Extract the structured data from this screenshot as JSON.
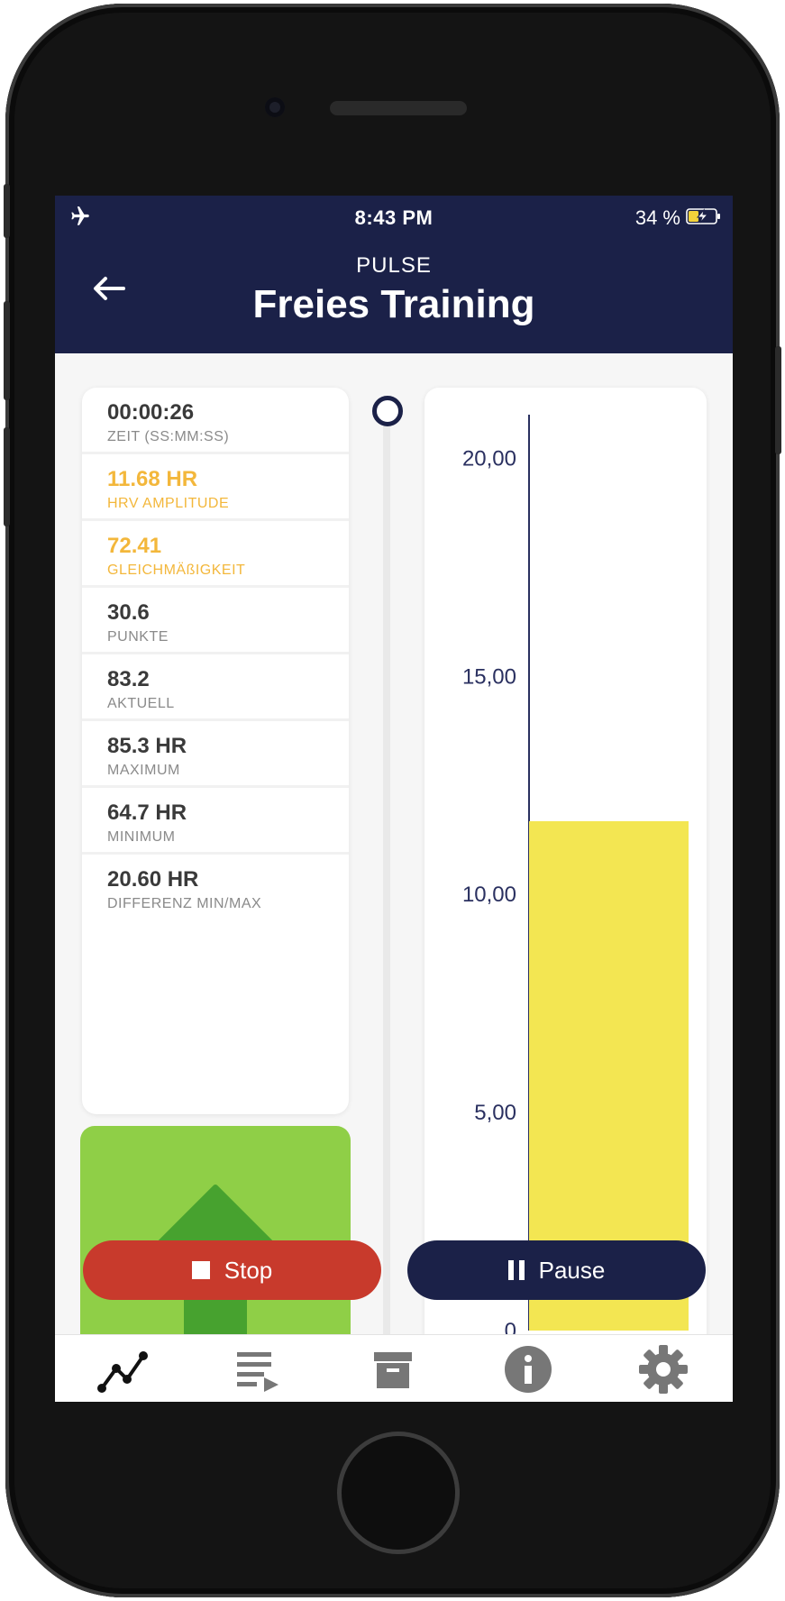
{
  "status_bar": {
    "time": "8:43 PM",
    "battery": "34 %",
    "icons": [
      "airplane-icon",
      "battery-charging-icon"
    ]
  },
  "header": {
    "subtitle": "PULSE",
    "title": "Freies Training",
    "back_icon": "arrow-left-icon"
  },
  "stats": [
    {
      "value": "00:00:26",
      "label": "ZEIT (SS:MM:SS)",
      "highlight": false
    },
    {
      "value": "11.68 HR",
      "label": "HRV AMPLITUDE",
      "highlight": true
    },
    {
      "value": "72.41",
      "label": "GLEICHMÄßIGKEIT",
      "highlight": true
    },
    {
      "value": "30.6",
      "label": "PUNKTE",
      "highlight": false
    },
    {
      "value": "83.2",
      "label": "AKTUELL",
      "highlight": false
    },
    {
      "value": "85.3 HR",
      "label": "MAXIMUM",
      "highlight": false
    },
    {
      "value": "64.7 HR",
      "label": "MINIMUM",
      "highlight": false
    },
    {
      "value": "20.60 HR",
      "label": "DIFFERENZ MIN/MAX",
      "highlight": false
    }
  ],
  "indicator": {
    "icon": "arrow-up-icon",
    "color": "#8fcf47",
    "arrow_color": "#47a22f"
  },
  "chart_data": {
    "type": "bar",
    "categories": [
      ""
    ],
    "values": [
      11.68
    ],
    "ylim": [
      0,
      21
    ],
    "y_ticks": [
      "0",
      "5,00",
      "10,00",
      "15,00",
      "20,00"
    ],
    "bar_color": "#f3e652",
    "title": "",
    "xlabel": "",
    "ylabel": ""
  },
  "buttons": {
    "stop_label": "Stop",
    "pause_label": "Pause"
  },
  "tabbar": {
    "items": [
      "chart-line-icon",
      "playlist-icon",
      "archive-icon",
      "info-icon",
      "gear-icon"
    ]
  },
  "colors": {
    "navy": "#1b2148",
    "red": "#c83a2c",
    "highlight": "#f3b73b"
  }
}
